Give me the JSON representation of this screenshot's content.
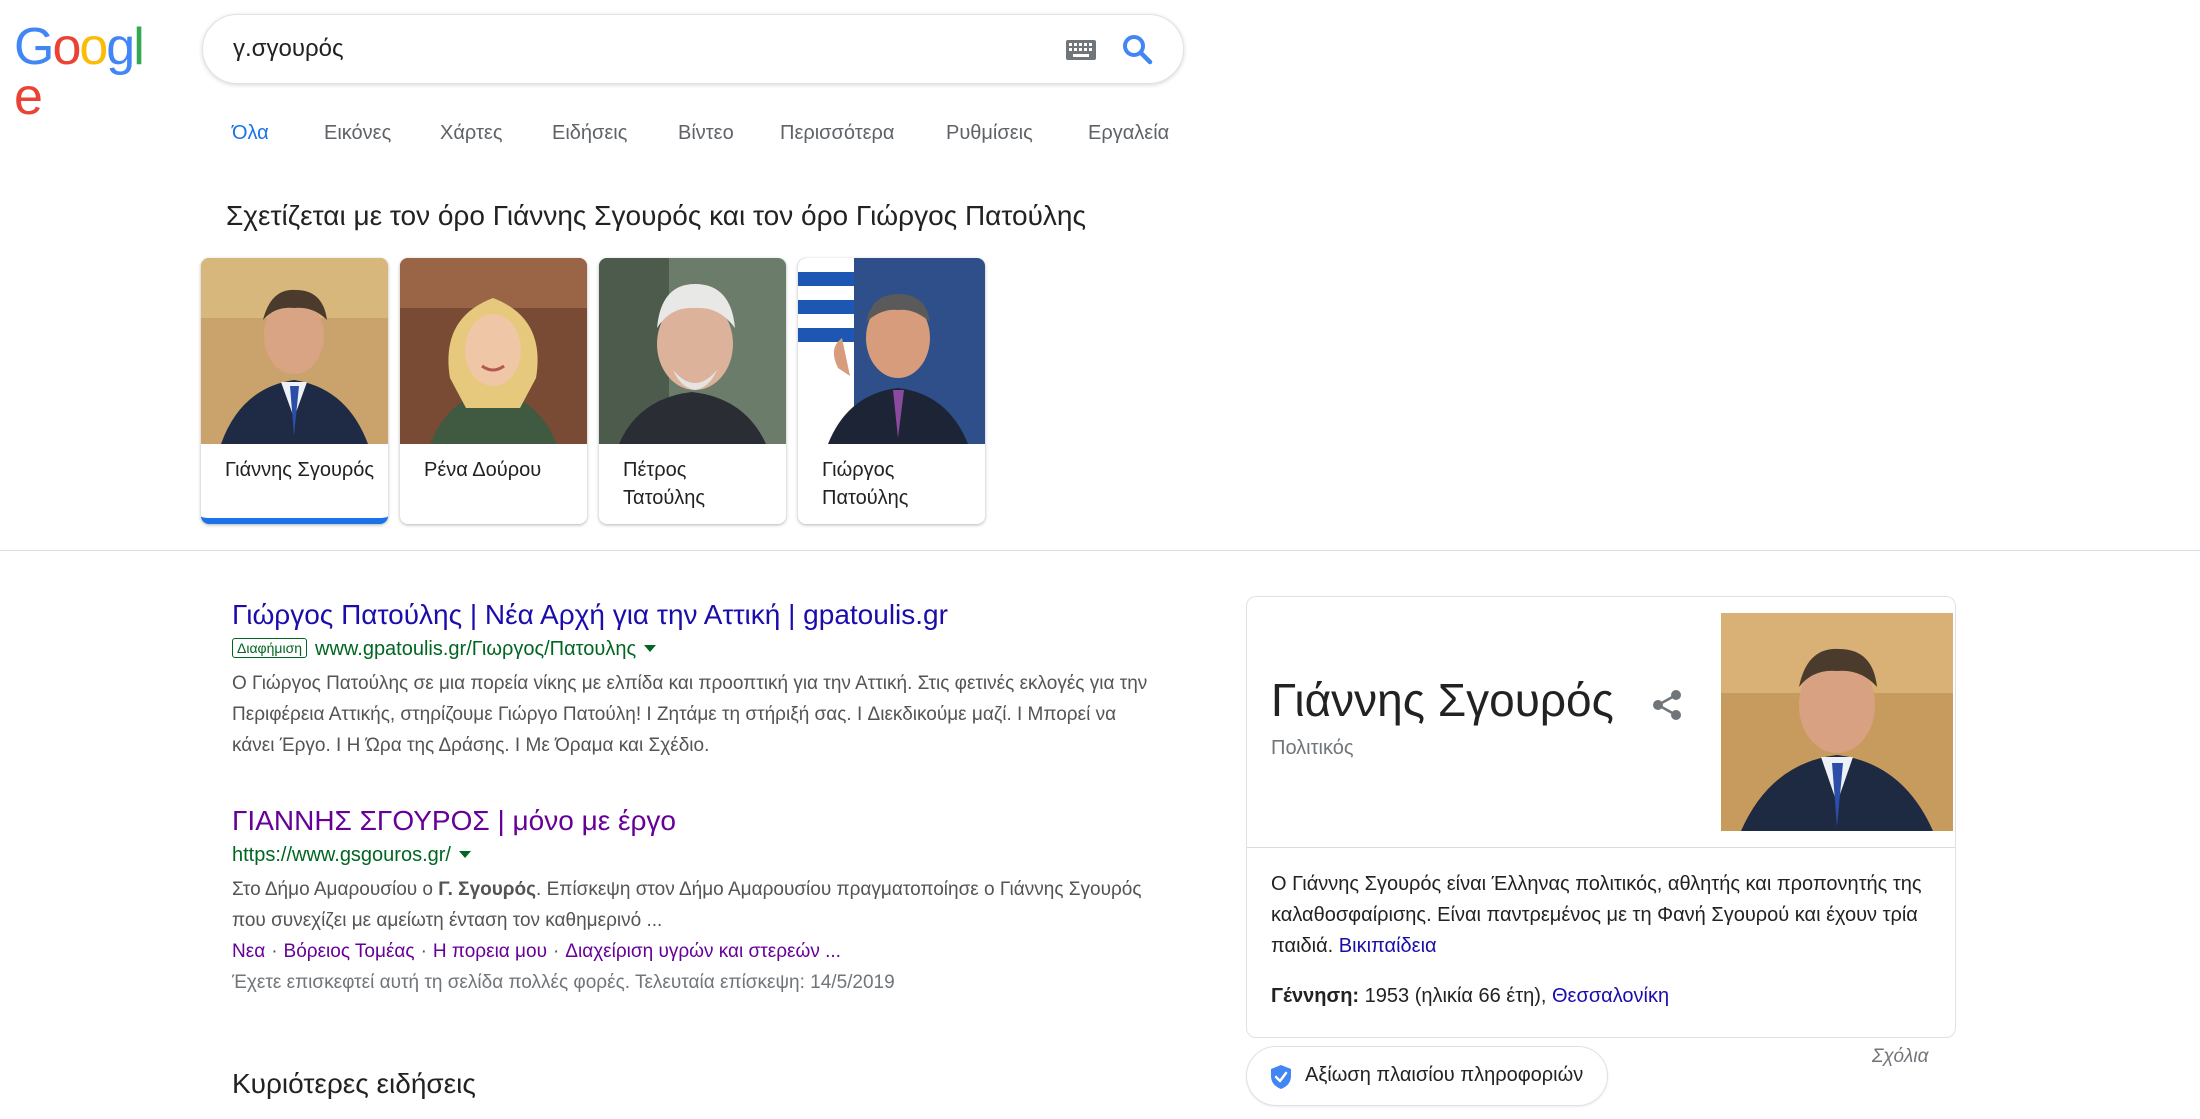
{
  "logo": {
    "letters": [
      "G",
      "o",
      "o",
      "g",
      "l",
      "e"
    ],
    "colors": [
      "#4285f4",
      "#ea4335",
      "#fbbc05",
      "#4285f4",
      "#34a853",
      "#ea4335"
    ]
  },
  "search": {
    "query": "γ.σγουρός",
    "keyboard_icon": "keyboard-icon",
    "search_icon": "search-icon",
    "accent": "#4285f4"
  },
  "tabs": [
    {
      "label": "Όλα",
      "active": true
    },
    {
      "label": "Εικόνες"
    },
    {
      "label": "Χάρτες"
    },
    {
      "label": "Ειδήσεις"
    },
    {
      "label": "Βίντεο"
    },
    {
      "label": "Περισσότερα"
    },
    {
      "label": "Ρυθμίσεις"
    },
    {
      "label": "Εργαλεία"
    }
  ],
  "related": {
    "title": "Σχετίζεται με τον όρο Γιάννης Σγουρός και τον όρο Γιώργος Πατούλης",
    "entities": [
      {
        "name": "Γιάννης Σγουρός",
        "selected": true
      },
      {
        "name": "Ρένα Δούρου"
      },
      {
        "name": "Πέτρος Τατούλης"
      },
      {
        "name": "Γιώργος Πατούλης"
      }
    ]
  },
  "results": [
    {
      "title": "Γιώργος Πατούλης | Νέα Αρχή για την Αττική | gpatoulis.gr",
      "ad_label": "Διαφήμιση",
      "url": "www.gpatoulis.gr/Γιωργος/Πατουλης",
      "snippet": "Ο Γιώργος Πατούλης σε μια πορεία νίκης με ελπίδα και προοπτική για την Αττική. Στις φετινές εκλογές για την Περιφέρεια Αττικής, στηρίζουμε Γιώργο Πατούλη! I Ζητάμε τη στήριξή σας. I Διεκδικούμε μαζί. I Μπορεί να κάνει Έργο. I Η Ώρα της Δράσης. I Με Όραμα και Σχέδιο."
    },
    {
      "title": "ΓΙΑΝΝΗΣ ΣΓΟΥΡΟΣ | μόνο με έργο",
      "url": "https://www.gsgouros.gr/",
      "snippet_pre": "Στο Δήμο Αμαρουσίου ο ",
      "snippet_bold": "Γ. Σγουρός",
      "snippet_post": ". Επίσκεψη στον Δήμο Αμαρουσίου πραγματοποίησε ο Γιάννης Σγουρός που συνεχίζει με αμείωτη ένταση τον καθημερινό ...",
      "sitelinks": [
        "Νεα",
        "Βόρειος Τομέας",
        "Η πορεια μου",
        "Διαχείριση υγρών και στερεών ..."
      ],
      "visited_note": "Έχετε επισκεφτεί αυτή τη σελίδα πολλές φορές. Τελευταία επίσκεψη: 14/5/2019"
    }
  ],
  "top_news_heading": "Κυριότερες ειδήσεις",
  "knowledge_panel": {
    "name": "Γιάννης Σγουρός",
    "type": "Πολιτικός",
    "description": "Ο Γιάννης Σγουρός είναι Έλληνας πολιτικός, αθλητής και προπονητής της καλαθοσφαίρισης. Είναι παντρεμένος με τη Φανή Σγουρού και έχουν τρία παιδιά.",
    "source_link": "Βικιπαίδεια",
    "birth_label": "Γέννηση:",
    "birth_value": "1953 (ηλικία 66 έτη),",
    "birth_place": "Θεσσαλονίκη"
  },
  "rate_button": "Αξίωση πλαισίου πληροφοριών",
  "feedback": "Σχόλια"
}
